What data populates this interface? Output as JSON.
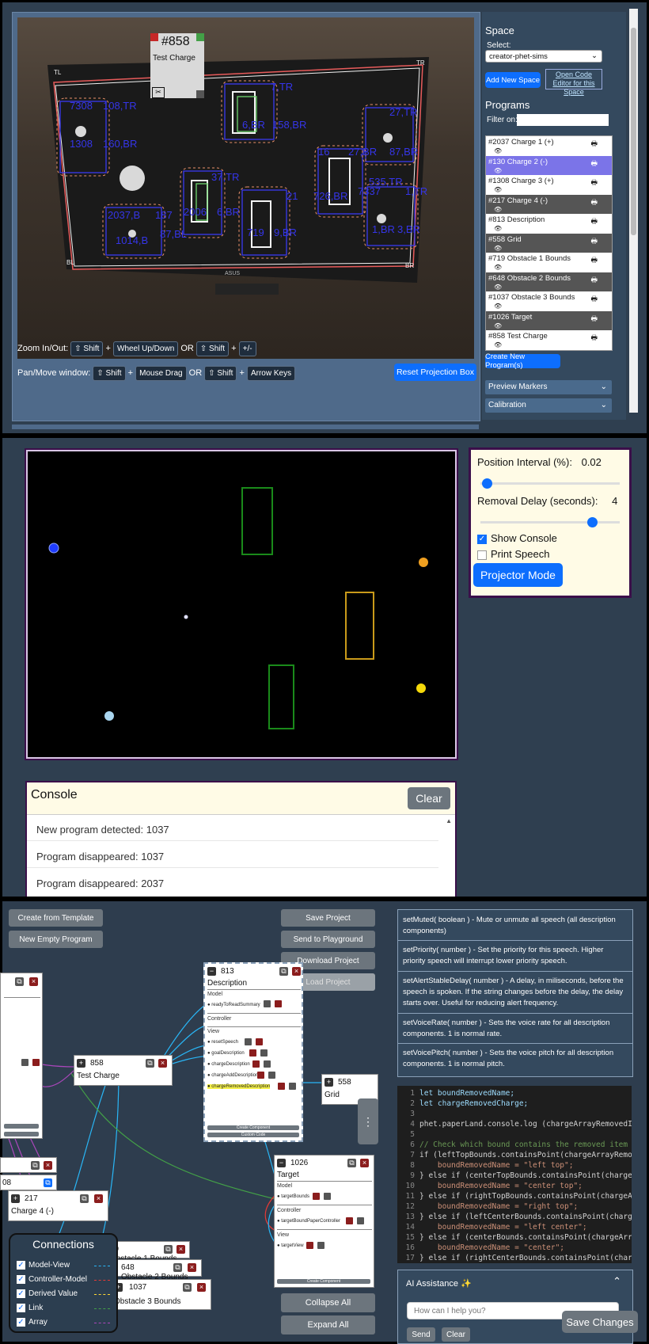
{
  "camera": {
    "card": {
      "id": "#858",
      "name": "Test Charge"
    },
    "corner_labels": {
      "tl": "TL",
      "tr": "TR",
      "bl": "BL",
      "br": "BR"
    },
    "marker_labels": [
      "7,TR",
      "108,TR",
      "1308,TL",
      "160,BR",
      "37,TR",
      "2037,BL",
      "87,BL",
      "1014,B",
      "2006,BL",
      "719,TR",
      "719,BL",
      "9,BR",
      "21",
      "27,TR",
      "7,BR",
      "9,TR",
      "535,TR",
      "1037,BL",
      "1,BR",
      "558",
      "8,BR",
      "3,BR"
    ]
  },
  "controls": {
    "zoom_label": "Zoom In/Out:",
    "pan_label": "Pan/Move window:",
    "shift": "⇧ Shift",
    "plus": "+",
    "wheel": "Wheel Up/Down",
    "or": "OR",
    "plusminus": "+/-",
    "mouse_drag": "Mouse Drag",
    "arrow_keys": "Arrow Keys",
    "reset_projection": "Reset Projection Box"
  },
  "space": {
    "heading": "Space",
    "select_label": "Select:",
    "selected": "creator-phet-sims",
    "add_new": "Add New Space",
    "open_editor": "Open Code Editor for this Space"
  },
  "programs": {
    "heading": "Programs",
    "filter_label": "Filter on:",
    "filter_value": "",
    "items": [
      {
        "label": "#2037 Charge 1 (+)",
        "style": "plain"
      },
      {
        "label": "#130 Charge 2 (-)",
        "style": "sel"
      },
      {
        "label": "#1308 Charge 3 (+)",
        "style": "plain"
      },
      {
        "label": "#217 Charge 4 (-)",
        "style": "alt"
      },
      {
        "label": "#813 Description",
        "style": "plain"
      },
      {
        "label": "#558 Grid",
        "style": "alt"
      },
      {
        "label": "#719 Obstacle 1 Bounds",
        "style": "plain"
      },
      {
        "label": "#648 Obstacle 2 Bounds",
        "style": "alt"
      },
      {
        "label": "#1037 Obstacle 3 Bounds",
        "style": "plain"
      },
      {
        "label": "#1026 Target",
        "style": "alt"
      },
      {
        "label": "#858 Test Charge",
        "style": "plain"
      }
    ],
    "create_new": "Create New Program(s)"
  },
  "accordions": {
    "preview": "Preview Markers",
    "calibration": "Calibration"
  },
  "settings": {
    "position_interval_label": "Position Interval (%):",
    "position_interval_value": "0.02",
    "position_interval_fraction": 0.02,
    "removal_delay_label": "Removal Delay (seconds):",
    "removal_delay_value": "4",
    "removal_delay_fraction": 0.8,
    "show_console": "Show Console",
    "show_console_checked": true,
    "print_speech": "Print Speech",
    "print_speech_checked": false,
    "projector_mode": "Projector Mode"
  },
  "console": {
    "title": "Console",
    "clear": "Clear",
    "lines": [
      "New program detected: 1037",
      "Program disappeared: 1037",
      "Program disappeared: 2037"
    ]
  },
  "creator": {
    "create_from_template": "Create from Template",
    "new_empty_program": "New Empty Program",
    "save_project": "Save Project",
    "send_to_playground": "Send to Playground",
    "download_project": "Download Project",
    "load_project": "Load Project",
    "collapse_all": "Collapse All",
    "expand_all": "Expand All",
    "save_changes": "Save Changes"
  },
  "nodes": {
    "description": {
      "id": "813",
      "name": "Description",
      "model": "Model",
      "controller": "Controller",
      "view": "View",
      "model_items": [
        "readyToReadSummary"
      ],
      "view_items": [
        "resetSpeech",
        "goalDescription",
        "chargeDescription",
        "chargeAddDescription",
        "chargeRemovedDescription"
      ],
      "create_component": "Create Component",
      "custom_code": "Custom Code"
    },
    "test_charge": {
      "id": "858",
      "name": "Test Charge"
    },
    "grid": {
      "id": "558",
      "name": "Grid"
    },
    "target": {
      "id": "1026",
      "name": "Target",
      "model": "Model",
      "controller": "Controller",
      "view": "View",
      "model_items": [
        "targetBounds"
      ],
      "controller_items": [
        "targetBoundPaperController"
      ],
      "view_items": [
        "targetView"
      ],
      "create_component": "Create Component"
    },
    "charge4": {
      "id": "217",
      "name": "Charge 4 (-)"
    },
    "partial08": {
      "id": "08"
    },
    "o648": {
      "id": "648",
      "name": "Obstacle 2 Bounds"
    },
    "o19": {
      "id": "19",
      "name": "Obstacle 1 Bounds"
    },
    "o1037": {
      "id": "1037",
      "name": "Obstacle 3 Bounds"
    }
  },
  "connections": {
    "title": "Connections",
    "items": [
      {
        "label": "Model-View",
        "color": "#29b6f6"
      },
      {
        "label": "Controller-Model",
        "color": "#e53935"
      },
      {
        "label": "Derived Value",
        "color": "#fdd835"
      },
      {
        "label": "Link",
        "color": "#43a047"
      },
      {
        "label": "Array",
        "color": "#ab47bc"
      }
    ]
  },
  "docs": [
    "setMuted( boolean ) - Mute or unmute all speech (all description components)",
    "setPriority( number ) - Set the priority for this speech. Higher priority speech will interrupt lower priority speech.",
    "setAlertStableDelay( number ) - A delay, in miliseconds, before the speech is spoken. If the string changes before the delay, the delay starts over. Useful for reducing alert frequency.",
    "setVoiceRate( number ) - Sets the voice rate for all description components. 1 is normal rate.",
    "setVoicePitch( number ) - Sets the voice pitch for all description components. 1 is normal pitch."
  ],
  "code_lines": [
    {
      "n": "1",
      "t": "let boundRemovedName;",
      "c": "#9cdcfe"
    },
    {
      "n": "2",
      "t": "let chargeRemovedCharge;",
      "c": "#9cdcfe"
    },
    {
      "n": "3",
      "t": "",
      "c": "#d4d4d4"
    },
    {
      "n": "4",
      "t": "phet.paperLand.console.log (chargeArrayRemovedItem",
      "c": "#d4d4d4"
    },
    {
      "n": "5",
      "t": "",
      "c": "#d4d4d4"
    },
    {
      "n": "6",
      "t": "// Check which bound contains the removed item",
      "c": "#6a9955"
    },
    {
      "n": "7",
      "t": "if (leftTopBounds.containsPoint(chargeArrayRemoved",
      "c": "#d4d4d4"
    },
    {
      "n": "8",
      "t": "    boundRemovedName = \"left top\";",
      "c": "#ce9178"
    },
    {
      "n": "9",
      "t": "} else if (centerTopBounds.containsPoint(chargeArr",
      "c": "#d4d4d4"
    },
    {
      "n": "10",
      "t": "    boundRemovedName = \"center top\";",
      "c": "#ce9178"
    },
    {
      "n": "11",
      "t": "} else if (rightTopBounds.containsPoint(chargeArra",
      "c": "#d4d4d4"
    },
    {
      "n": "12",
      "t": "    boundRemovedName = \"right top\";",
      "c": "#ce9178"
    },
    {
      "n": "13",
      "t": "} else if (leftCenterBounds.containsPoint(chargeAr",
      "c": "#d4d4d4"
    },
    {
      "n": "14",
      "t": "    boundRemovedName = \"left center\";",
      "c": "#ce9178"
    },
    {
      "n": "15",
      "t": "} else if (centerBounds.containsPoint(chargeArrayR",
      "c": "#d4d4d4"
    },
    {
      "n": "16",
      "t": "    boundRemovedName = \"center\";",
      "c": "#ce9178"
    },
    {
      "n": "17",
      "t": "} else if (rightCenterBounds.containsPoint(chargeA",
      "c": "#d4d4d4"
    }
  ],
  "ai": {
    "title": "AI Assistance ✨",
    "placeholder": "How can I help you?",
    "send": "Send",
    "clear": "Clear"
  }
}
